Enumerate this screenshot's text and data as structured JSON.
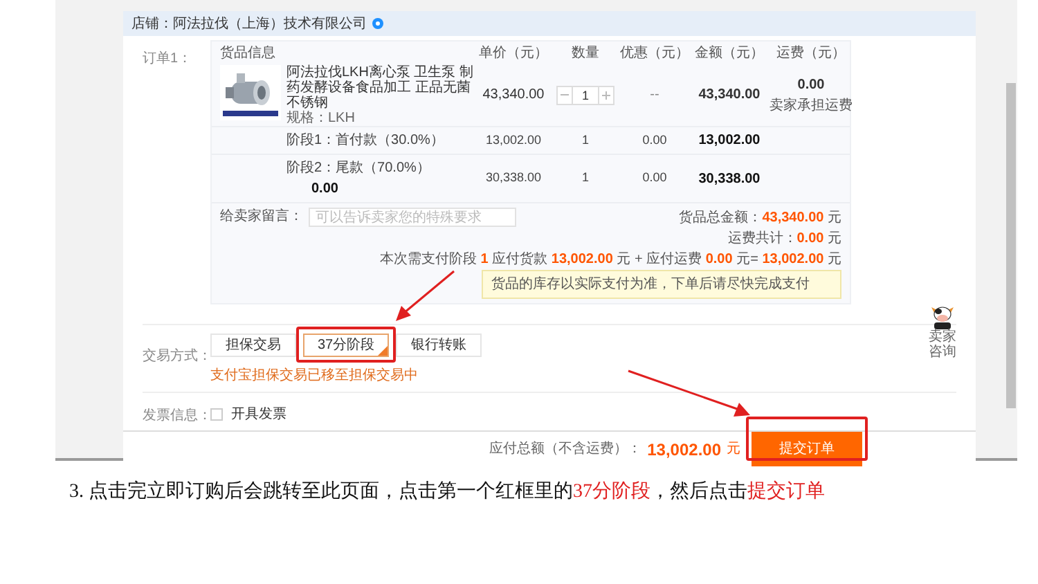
{
  "store": {
    "label": "店铺：阿法拉伐（上海）技术有限公司"
  },
  "order": {
    "label": "订单1：",
    "columns": [
      "货品信息",
      "单价（元）",
      "数量",
      "优惠（元）",
      "金额（元）",
      "运费（元）"
    ],
    "product": {
      "name": "阿法拉伐LKH离心泵 卫生泵 制药发酵设备食品加工 正品无菌不锈钢",
      "spec": "规格：LKH",
      "unit_price": "43,340.00",
      "quantity": "1",
      "discount": "--",
      "amount": "43,340.00",
      "shipping": "0.00",
      "shipping_note": "卖家承担运费"
    },
    "stages": [
      {
        "label": "阶段1：首付款（30.0%）",
        "unit_price": "13,002.00",
        "quantity": "1",
        "discount": "0.00",
        "amount": "13,002.00"
      },
      {
        "label": "阶段2：尾款（70.0%）",
        "extra": "0.00",
        "unit_price": "30,338.00",
        "quantity": "1",
        "discount": "0.00",
        "amount": "30,338.00"
      }
    ],
    "message": {
      "label": "给卖家留言：",
      "placeholder": "可以告诉卖家您的特殊要求"
    },
    "summary": [
      "货品总金额：**43,340.00** 元",
      "运费共计：**0.00** 元",
      "本次需支付阶段 **1** 应付货款 **13,002.00** 元 + 应付运费 **0.00** 元= **13,002.00** 元"
    ],
    "notice": "货品的库存以实际支付为准，下单后请尽快完成支付"
  },
  "trade": {
    "label": "交易方式：",
    "options": [
      {
        "label": "担保交易",
        "selected": false
      },
      {
        "label": "37分阶段",
        "selected": true
      },
      {
        "label": "银行转账",
        "selected": false
      }
    ],
    "note": "支付宝担保交易已移至担保交易中"
  },
  "invoice": {
    "label": "发票信息：",
    "option": "开具发票",
    "checked": false
  },
  "footer": {
    "label": "应付总额（不含运费）：",
    "amount": "13,002.00",
    "unit": "元",
    "submit": "提交订单"
  },
  "chat": {
    "label": "卖家咨询"
  },
  "caption": "3. 点击完立即订购后会跳转至此页面，点击第一个红框里的**37分阶段**，然后点击**提交订单**"
}
